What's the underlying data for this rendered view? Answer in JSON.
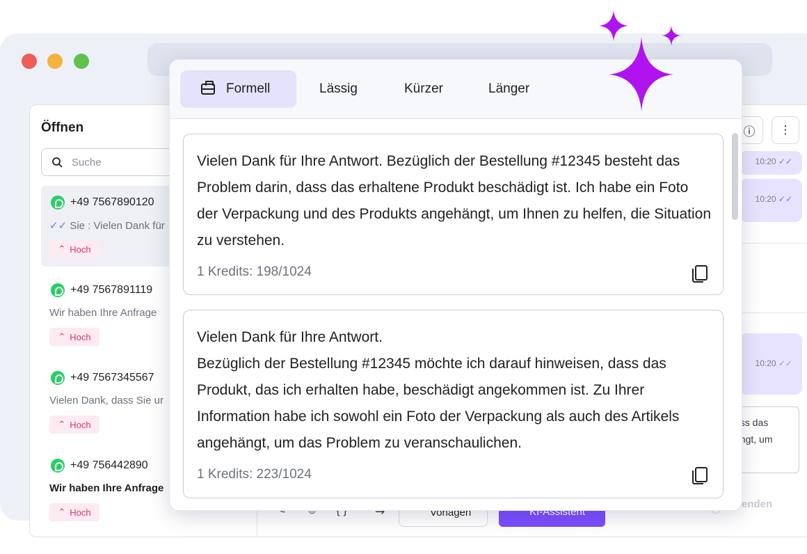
{
  "colors": {
    "accent": "#b012f0",
    "primary": "#7b4dff",
    "badge": "#d6336c",
    "active_tab": "#e5e3fb"
  },
  "sidebar": {
    "title": "Öffnen",
    "search_placeholder": "Suche",
    "conversations": [
      {
        "phone": "+49 7567890120",
        "preview": "Sie : Vielen Dank für",
        "priority": "Hoch",
        "active": true,
        "sent_by_me": true
      },
      {
        "phone": "+49 7567891119",
        "preview": "Wir haben Ihre Anfrage",
        "priority": "Hoch"
      },
      {
        "phone": "+49 7567345567",
        "preview": "Vielen Dank, dass Sie ur",
        "priority": "Hoch"
      },
      {
        "phone": "+49 756442890",
        "preview": "Wir haben Ihre Anfrage",
        "priority": "Hoch",
        "unread": true
      }
    ]
  },
  "chat": {
    "times": [
      "10:20",
      "10:20",
      "10:20"
    ],
    "draft_lines": [
      "ass das",
      "ängt, um"
    ],
    "toolbar": {
      "templates": "Vorlagen",
      "ai_assistant": "KI-Assistent",
      "send": "Senden"
    }
  },
  "popup": {
    "tabs": [
      "Formell",
      "Lässig",
      "Kürzer",
      "Länger"
    ],
    "active_tab": "Formell",
    "suggestions": [
      {
        "text": "Vielen Dank für Ihre Antwort. Bezüglich der Bestellung #12345 besteht das Problem darin, dass das erhaltene Produkt beschädigt ist. Ich habe ein Foto der Verpackung und des Produkts angehängt, um Ihnen zu helfen, die Situation zu verstehen.",
        "credits": "1 Kredits: 198/1024"
      },
      {
        "text": "Vielen Dank für Ihre Antwort.\nBezüglich der Bestellung #12345 möchte ich darauf hinweisen, dass das Produkt, das ich erhalten habe, beschädigt angekommen ist. Zu Ihrer Information habe ich sowohl ein Foto der Verpackung als auch des Artikels angehängt, um das Problem zu veranschaulichen.",
        "credits": "1 Kredits: 223/1024"
      }
    ]
  }
}
